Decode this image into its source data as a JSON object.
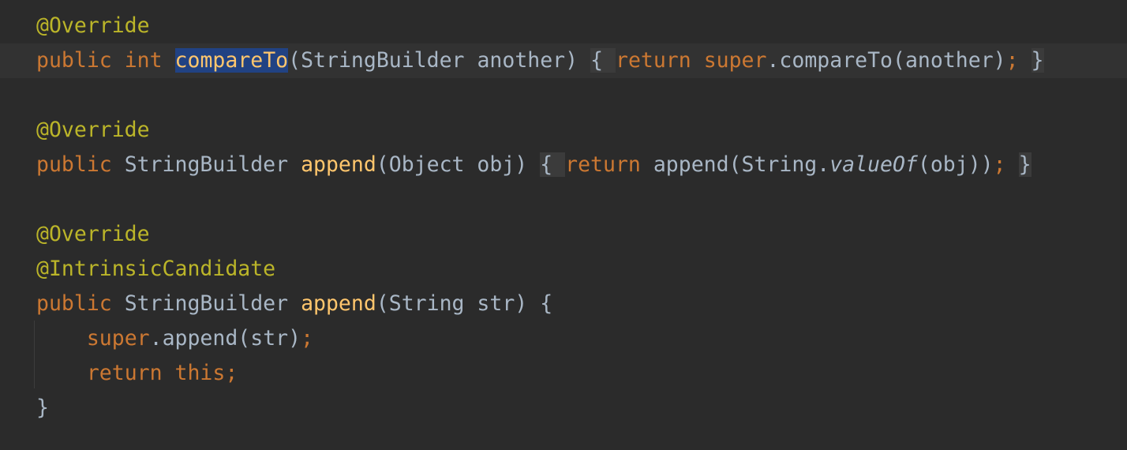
{
  "editor": {
    "lines": [
      {
        "tokens": [
          {
            "text": "@Override",
            "kind": "ann"
          }
        ]
      },
      {
        "tokens": [
          {
            "text": "public",
            "kind": "kw"
          },
          {
            "text": " ",
            "kind": "plain"
          },
          {
            "text": "int",
            "kind": "kw"
          },
          {
            "text": " ",
            "kind": "plain"
          },
          {
            "text": "compareTo",
            "kind": "sel"
          },
          {
            "text": "(StringBuilder another)",
            "kind": "plain"
          },
          {
            "text": " ",
            "kind": "plain"
          },
          {
            "text": "{ ",
            "kind": "fold"
          },
          {
            "text": "return",
            "kind": "kw"
          },
          {
            "text": " ",
            "kind": "plain"
          },
          {
            "text": "super",
            "kind": "kw"
          },
          {
            "text": ".compareTo(another)",
            "kind": "plain"
          },
          {
            "text": ";",
            "kind": "kw"
          },
          {
            "text": " ",
            "kind": "plain"
          },
          {
            "text": "}",
            "kind": "fold"
          }
        ]
      },
      {
        "tokens": []
      },
      {
        "tokens": [
          {
            "text": "@Override",
            "kind": "ann"
          }
        ]
      },
      {
        "tokens": [
          {
            "text": "public",
            "kind": "kw"
          },
          {
            "text": " StringBuilder ",
            "kind": "plain"
          },
          {
            "text": "append",
            "kind": "mth"
          },
          {
            "text": "(Object obj)",
            "kind": "plain"
          },
          {
            "text": " ",
            "kind": "plain"
          },
          {
            "text": "{ ",
            "kind": "fold"
          },
          {
            "text": "return",
            "kind": "kw"
          },
          {
            "text": " append(String.",
            "kind": "plain"
          },
          {
            "text": "valueOf",
            "kind": "ital"
          },
          {
            "text": "(obj))",
            "kind": "plain"
          },
          {
            "text": ";",
            "kind": "kw"
          },
          {
            "text": " ",
            "kind": "plain"
          },
          {
            "text": "}",
            "kind": "fold"
          }
        ]
      },
      {
        "tokens": []
      },
      {
        "tokens": [
          {
            "text": "@Override",
            "kind": "ann"
          }
        ]
      },
      {
        "tokens": [
          {
            "text": "@IntrinsicCandidate",
            "kind": "ann"
          }
        ]
      },
      {
        "tokens": [
          {
            "text": "public",
            "kind": "kw"
          },
          {
            "text": " StringBuilder ",
            "kind": "plain"
          },
          {
            "text": "append",
            "kind": "mth"
          },
          {
            "text": "(String str) {",
            "kind": "plain"
          }
        ]
      },
      {
        "tokens": [
          {
            "text": "    ",
            "kind": "plain"
          },
          {
            "text": "super",
            "kind": "kw"
          },
          {
            "text": ".append(str)",
            "kind": "plain"
          },
          {
            "text": ";",
            "kind": "kw"
          }
        ]
      },
      {
        "tokens": [
          {
            "text": "    ",
            "kind": "plain"
          },
          {
            "text": "return this;",
            "kind": "kw"
          }
        ]
      },
      {
        "tokens": [
          {
            "text": "}",
            "kind": "plain"
          }
        ]
      }
    ]
  },
  "colors": {
    "background": "#2b2b2b",
    "caret_row": "#323232",
    "keyword": "#cc7832",
    "annotation": "#bbb529",
    "method": "#ffc66d",
    "plain": "#a9b7c6",
    "selection": "#214283",
    "fold_region": "#3b3b3b"
  }
}
